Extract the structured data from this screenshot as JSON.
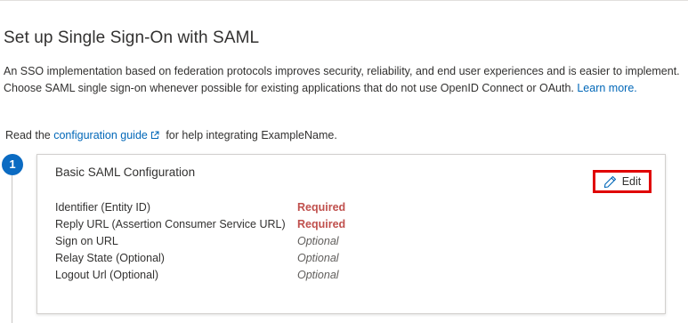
{
  "page": {
    "title": "Set up Single Sign-On with SAML",
    "intro_text": "An SSO implementation based on federation protocols improves security, reliability, and end user experiences and is easier to implement. Choose SAML single sign-on whenever possible for existing applications that do not use OpenID Connect or OAuth. ",
    "learn_more_link": "Learn more.",
    "read_prefix": "Read the ",
    "config_guide_link": "configuration guide",
    "read_suffix": " for help integrating ExampleName."
  },
  "step": {
    "number": "1"
  },
  "card": {
    "title": "Basic SAML Configuration",
    "edit_label": "Edit",
    "fields": [
      {
        "label": "Identifier (Entity ID)",
        "status": "Required"
      },
      {
        "label": "Reply URL (Assertion Consumer Service URL)",
        "status": "Required"
      },
      {
        "label": "Sign on URL",
        "status": "Optional"
      },
      {
        "label": "Relay State (Optional)",
        "status": "Optional"
      },
      {
        "label": "Logout Url (Optional)",
        "status": "Optional"
      }
    ]
  },
  "icons": {
    "external_link": "external-link-icon",
    "edit": "pencil-icon"
  },
  "colors": {
    "link": "#0067b8",
    "step_circle": "#0b6bc2",
    "required": "#c0504d",
    "highlight_border": "#e00000"
  }
}
